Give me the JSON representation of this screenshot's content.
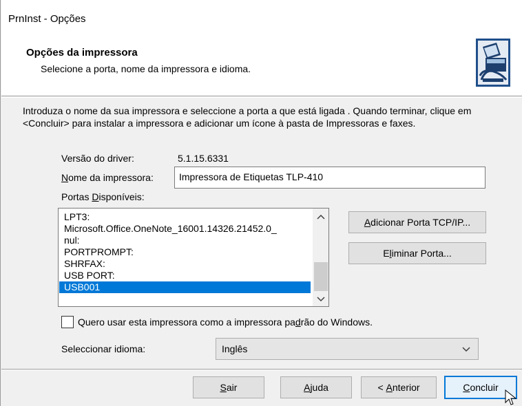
{
  "window": {
    "title": "PrnInst - Opções"
  },
  "header": {
    "title": "Opções da impressora",
    "subtitle": "Selecione a porta, nome da impressora e idioma.",
    "icon": "printer-icon"
  },
  "intro_text": "Introduza o nome da sua impressora e seleccione a porta a que está ligada . Quando terminar, clique em <Concluir> para instalar a impressora e adicionar um ícone à pasta de Impressoras e faxes.",
  "driver": {
    "label": "Versão do driver:",
    "value": "5.1.15.6331"
  },
  "printer_name": {
    "label_pre": "",
    "label_u": "N",
    "label_post": "ome da impressora:",
    "value": "Impressora de Etiquetas TLP-410"
  },
  "ports": {
    "label_pre": "Portas ",
    "label_u": "D",
    "label_post": "isponíveis:",
    "items": [
      "LPT3:",
      "Microsoft.Office.OneNote_16001.14326.21452.0_",
      "nul:",
      "PORTPROMPT:",
      "SHRFAX:",
      "USB PORT:",
      "USB001"
    ],
    "selected_index": 6
  },
  "buttons": {
    "add_port_u": "A",
    "add_port_rest": "dicionar Porta TCP/IP...",
    "remove_port_pre": "E",
    "remove_port_u": "l",
    "remove_port_post": "iminar Porta...",
    "exit_u": "S",
    "exit_rest": "air",
    "help_u": "A",
    "help_rest": "juda",
    "back_pre": "< ",
    "back_u": "A",
    "back_rest": "nterior",
    "finish_u": "C",
    "finish_rest": "oncluir"
  },
  "default_printer": {
    "checked": false,
    "label_pre": "Quero usar esta impressora como a impressora pa",
    "label_u": "d",
    "label_post": "rão do Windows."
  },
  "language": {
    "label": "Seleccionar idioma:",
    "selected": "Inglês"
  },
  "colors": {
    "selection": "#0078d7",
    "default_button_border": "#0078d7"
  }
}
